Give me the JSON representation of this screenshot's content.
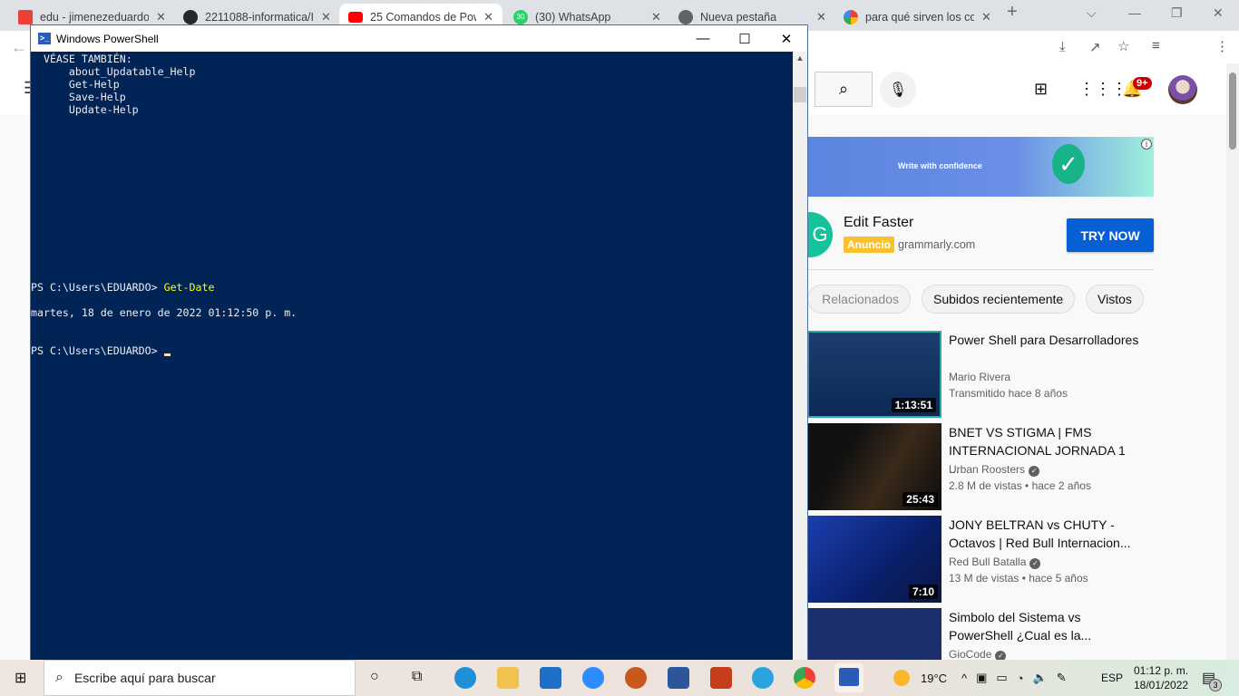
{
  "browser": {
    "tabs": [
      {
        "title": "edu - jimenezeduardo",
        "icon": "gmail-icon",
        "color": "#ea4335"
      },
      {
        "title": "2211088-informatica/I",
        "icon": "github-icon",
        "color": "#24292e"
      },
      {
        "title": "25 Comandos de Power",
        "icon": "youtube-icon",
        "color": "#ff0000"
      },
      {
        "title": "(30) WhatsApp",
        "icon": "whatsapp-icon",
        "color": "#25d366",
        "badge": "30"
      },
      {
        "title": "Nueva pestaña",
        "icon": "chrome-icon",
        "color": "#5f6368"
      },
      {
        "title": "para qué sirven los co",
        "icon": "google-icon",
        "color": "#4285f4"
      }
    ],
    "new_tab": "+"
  },
  "youtube": {
    "notif_badge": "9+",
    "ad": {
      "banner_text": "Write with confidence",
      "title": "Edit Faster",
      "badge": "Anuncio",
      "domain": "grammarly.com",
      "cta": "TRY NOW"
    },
    "chips": [
      "Relacionados",
      "Subidos recientemente",
      "Vistos"
    ],
    "videos": [
      {
        "title": "Power Shell para Desarrolladores",
        "channel": "Mario Rivera",
        "meta": "Transmitido hace 8 años",
        "duration": "1:13:51",
        "verified": false
      },
      {
        "title": "BNET VS STIGMA | FMS INTERNACIONAL JORNADA 1 ...",
        "channel": "Urban Roosters",
        "meta": "2.8 M de vistas • hace 2 años",
        "duration": "25:43",
        "verified": true
      },
      {
        "title": "JONY BELTRAN vs CHUTY - Octavos | Red Bull Internacion...",
        "channel": "Red Bull Batalla",
        "meta": "13 M de vistas • hace 5 años",
        "duration": "7:10",
        "verified": true
      },
      {
        "title": "Simbolo del Sistema vs PowerShell ¿Cual es la...",
        "channel": "GioCode",
        "meta": "",
        "duration": "",
        "verified": true
      }
    ]
  },
  "powershell": {
    "title": "Windows PowerShell",
    "lines": [
      "  VÉASE TAMBIÉN:",
      "      about_Updatable_Help",
      "      Get-Help",
      "      Save-Help",
      "      Update-Help"
    ],
    "prompt": "PS C:\\Users\\EDUARDO> ",
    "command": "Get-Date",
    "output": "martes, 18 de enero de 2022 01:12:50 p. m.",
    "prompt2": "PS C:\\Users\\EDUARDO> "
  },
  "taskbar": {
    "search_placeholder": "Escribe aquí para buscar",
    "weather": "19°C",
    "lang": "ESP",
    "time": "01:12 p. m.",
    "date": "18/01/2022",
    "notifications": "3"
  }
}
